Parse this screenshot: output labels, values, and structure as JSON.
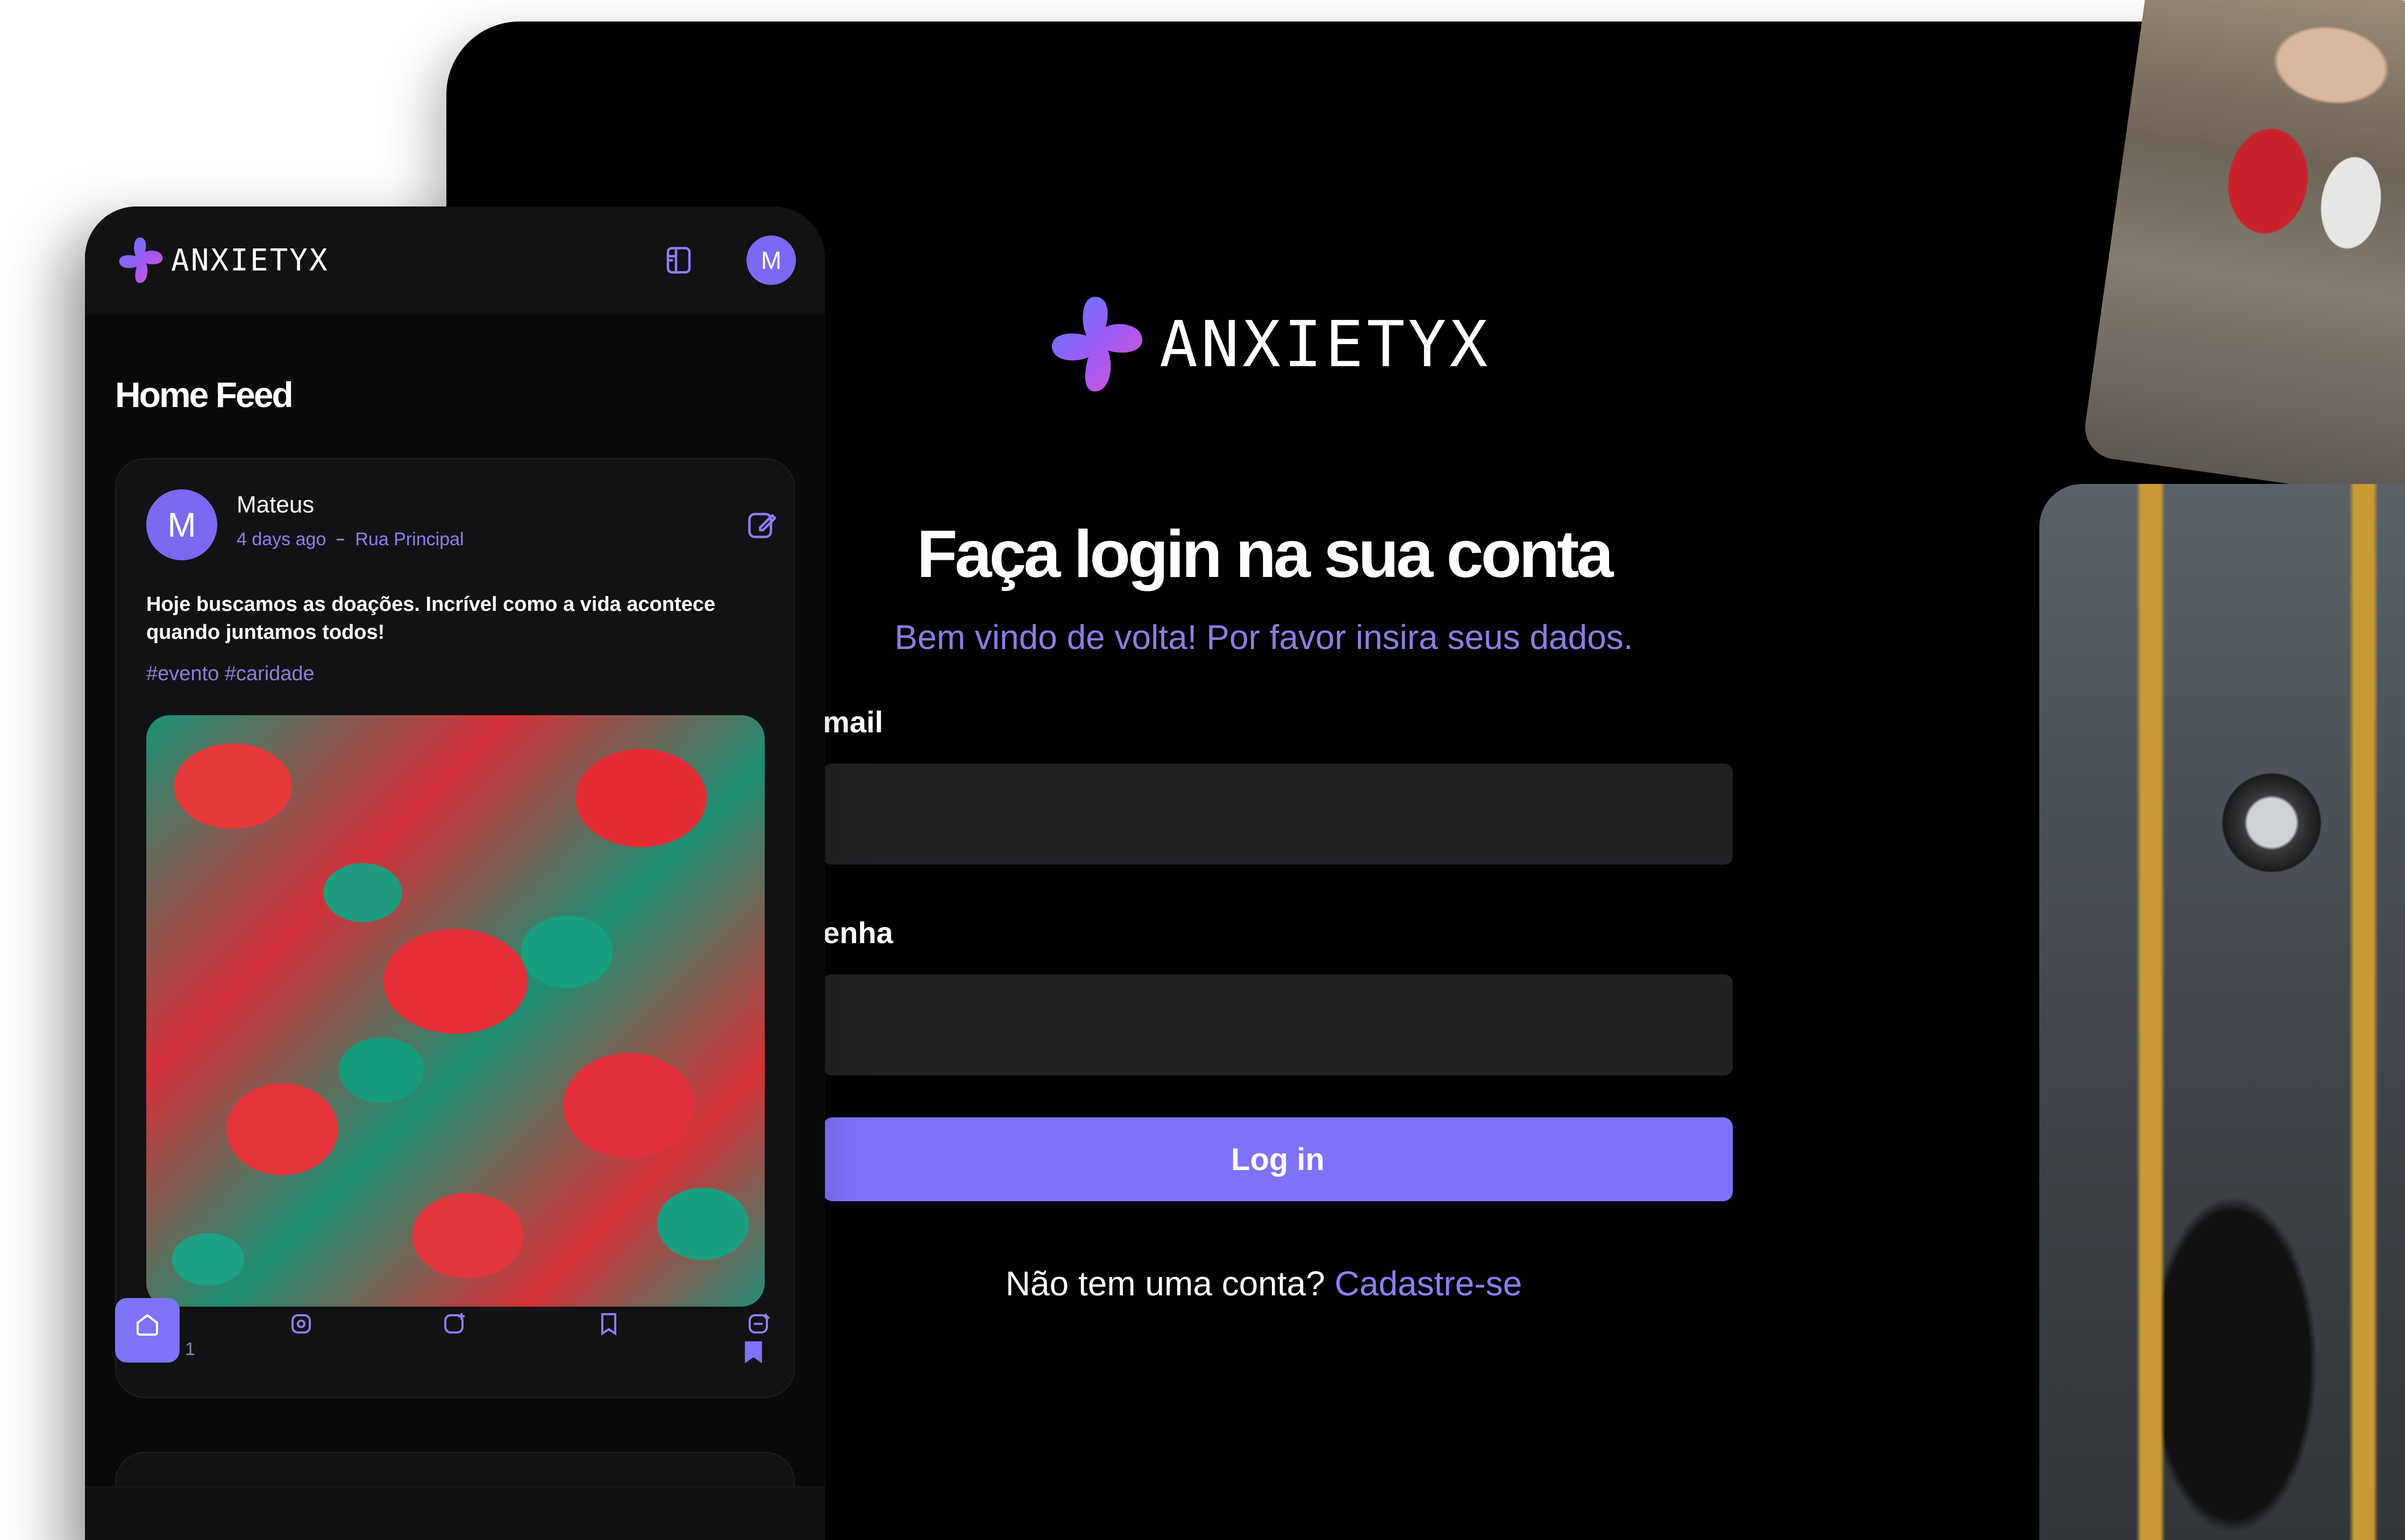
{
  "brand": {
    "name": "ANXIETYX"
  },
  "login": {
    "title": "Faça login na sua conta",
    "subtitle": "Bem vindo de volta! Por favor insira seus dados.",
    "email_label": "mail",
    "email_value": "",
    "password_label": "enha",
    "password_value": "",
    "submit_label": "Log in",
    "signup_prompt": "Não tem uma conta?",
    "signup_link": "Cadastre-se"
  },
  "mobile": {
    "avatar_initial": "M",
    "feed_title": "Home Feed",
    "post": {
      "avatar_initial": "M",
      "author": "Mateus",
      "time": "4 days ago",
      "location": "Rua Principal",
      "text": "Hoje buscamos as doações. Incrível como a vida acontece quando juntamos todos!",
      "tags": "#evento #caridade",
      "likes": "1"
    },
    "nav": [
      "home-icon",
      "explore-icon",
      "add-post-icon",
      "bookmarks-icon",
      "messages-icon"
    ]
  },
  "colors": {
    "accent": "#7f72fb",
    "avatar": "#7b69f2",
    "input_bg": "#212124",
    "subtitle": "#8a7fe0"
  }
}
